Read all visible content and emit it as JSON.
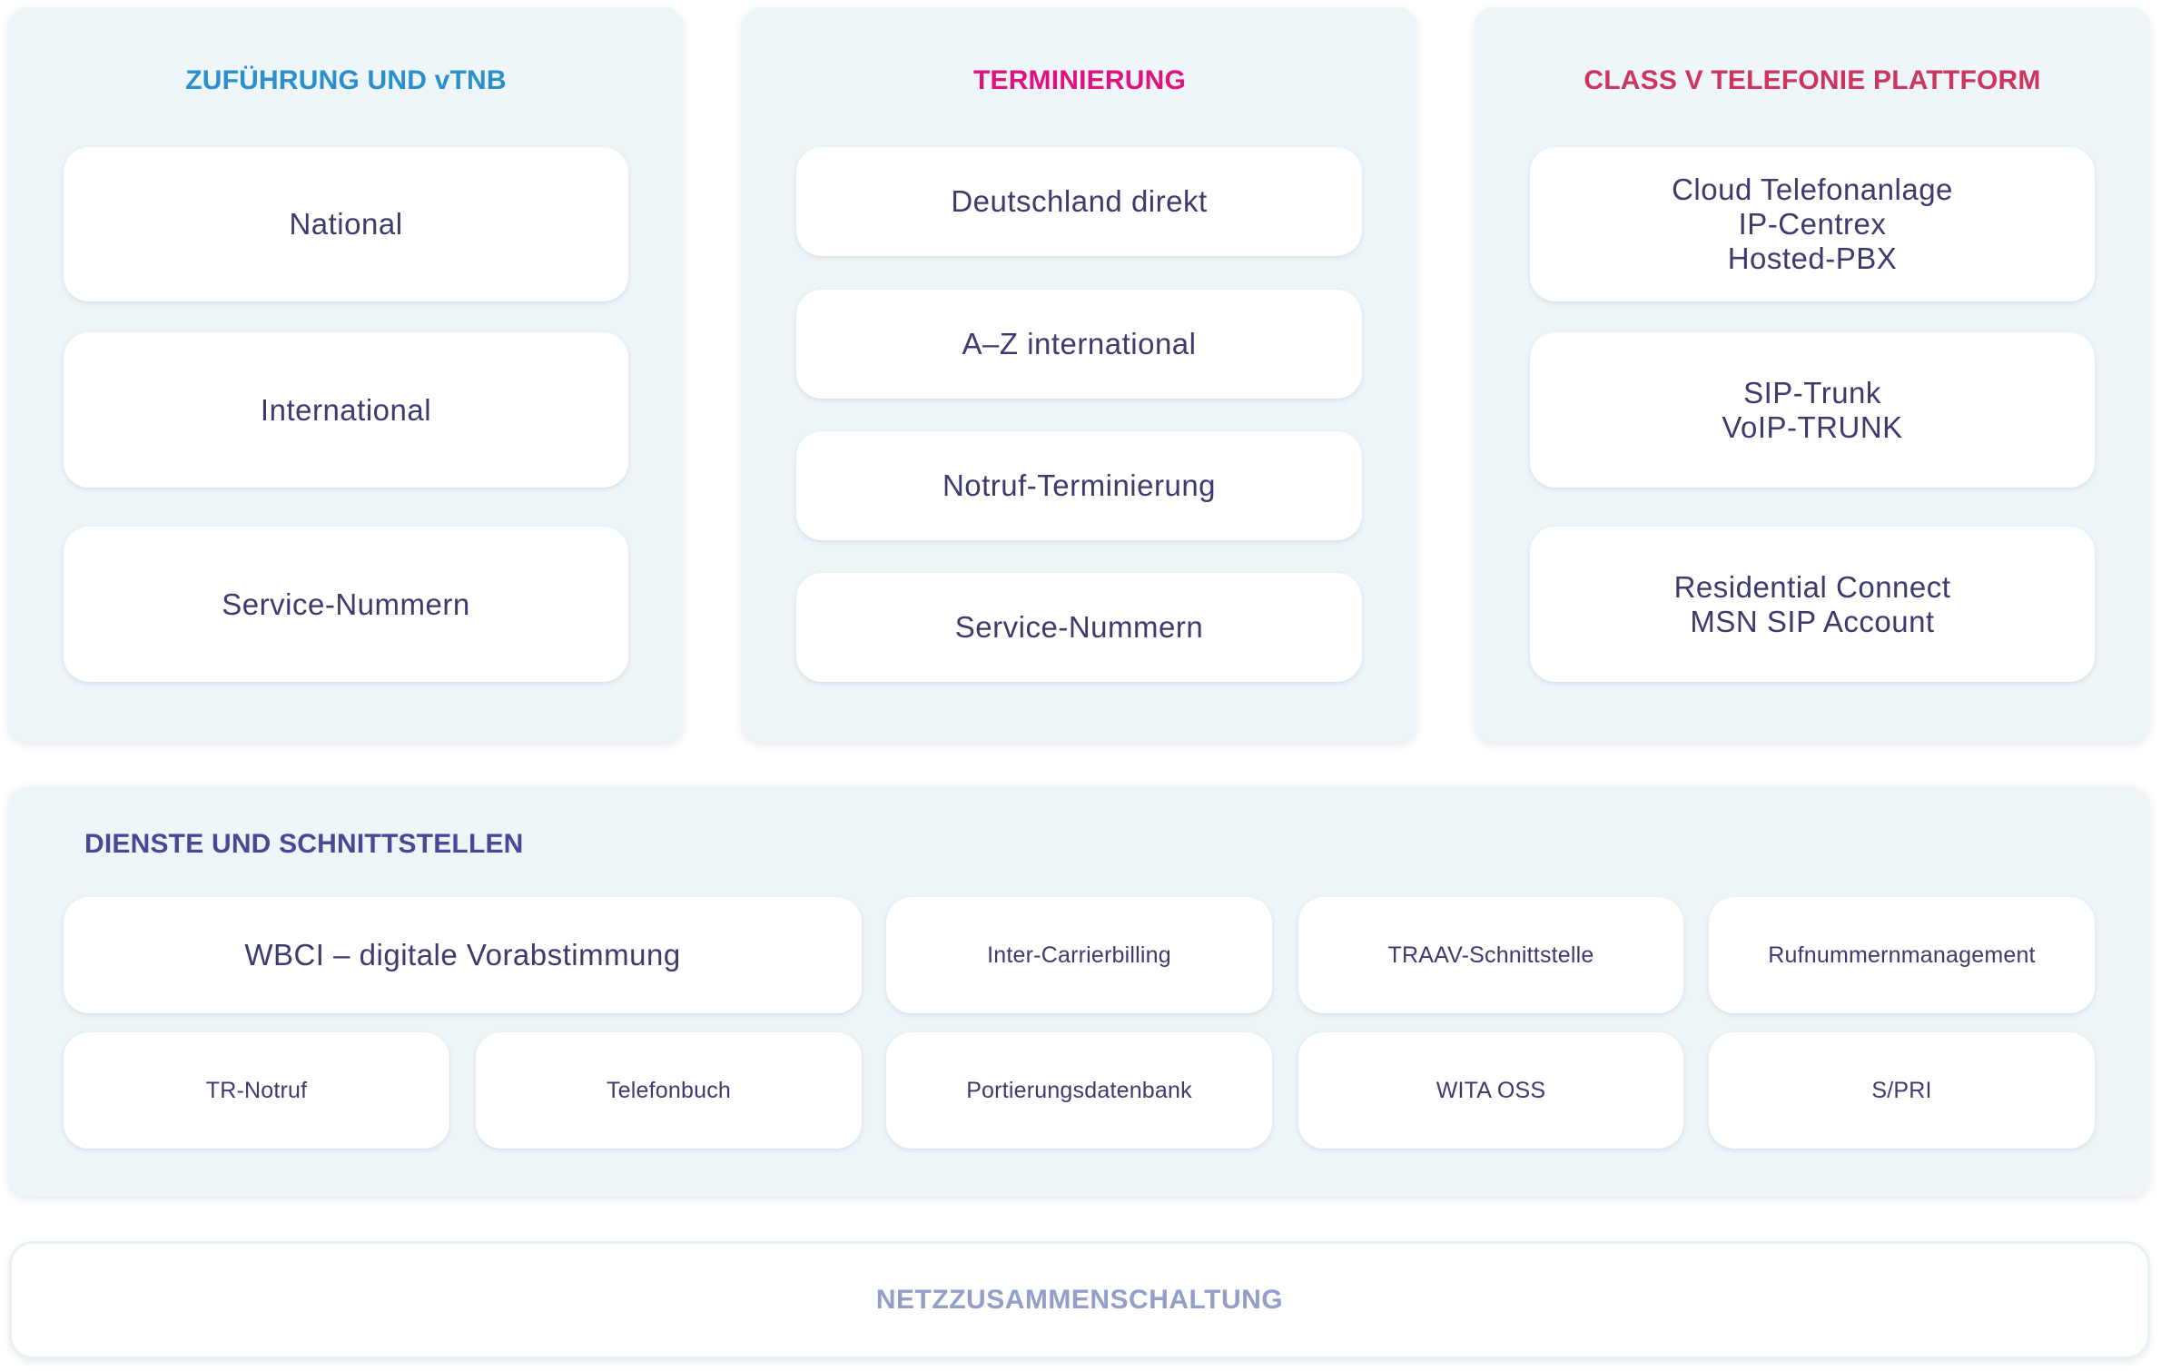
{
  "colors": {
    "zufuehrung_title": "#2b8fcc",
    "terminierung_title": "#e0127f",
    "classv_title": "#cc3560",
    "dienste_title": "#4a4797",
    "netz_label": "#959dc9",
    "card_text": "#3d3a6e",
    "panel_bg": "#eff6fa"
  },
  "panels": {
    "zufuehrung": {
      "title": "ZUFÜHRUNG UND vTNB",
      "items": [
        "National",
        "International",
        "Service-Nummern"
      ]
    },
    "terminierung": {
      "title": "TERMINIERUNG",
      "items": [
        "Deutschland direkt",
        "A–Z international",
        "Notruf-Terminierung",
        "Service-Nummern"
      ]
    },
    "classv": {
      "title": "CLASS V TELEFONIE PLATTFORM",
      "items": [
        "Cloud Telefonanlage\nIP-Centrex\nHosted-PBX",
        "SIP-Trunk\nVoIP-TRUNK",
        "Residential Connect\nMSN SIP Account"
      ]
    }
  },
  "dienste": {
    "title": "DIENSTE UND SCHNITTSTELLEN",
    "row1": [
      "WBCI – digitale Vorabstimmung",
      "Inter-Carrierbilling",
      "TRAAV-Schnittstelle",
      "Rufnummernmanagement"
    ],
    "row2": [
      "TR-Notruf",
      "Telefonbuch",
      "Portierungsdatenbank",
      "WITA OSS",
      "S/PRI"
    ]
  },
  "netz": {
    "label": "NETZZUSAMMENSCHALTUNG"
  }
}
